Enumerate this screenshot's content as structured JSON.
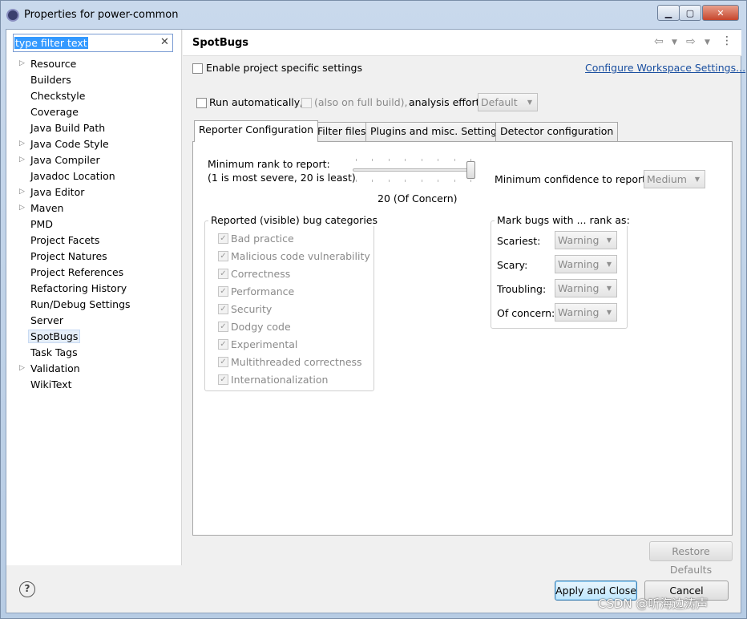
{
  "window": {
    "title": "Properties for power-common"
  },
  "filter": {
    "text": "type filter text",
    "clear_icon": "✕"
  },
  "tree": {
    "items": [
      {
        "label": "Resource",
        "expandable": true
      },
      {
        "label": "Builders",
        "expandable": false
      },
      {
        "label": "Checkstyle",
        "expandable": false
      },
      {
        "label": "Coverage",
        "expandable": false
      },
      {
        "label": "Java Build Path",
        "expandable": false
      },
      {
        "label": "Java Code Style",
        "expandable": true
      },
      {
        "label": "Java Compiler",
        "expandable": true
      },
      {
        "label": "Javadoc Location",
        "expandable": false
      },
      {
        "label": "Java Editor",
        "expandable": true
      },
      {
        "label": "Maven",
        "expandable": true
      },
      {
        "label": "PMD",
        "expandable": false
      },
      {
        "label": "Project Facets",
        "expandable": false
      },
      {
        "label": "Project Natures",
        "expandable": false
      },
      {
        "label": "Project References",
        "expandable": false
      },
      {
        "label": "Refactoring History",
        "expandable": false
      },
      {
        "label": "Run/Debug Settings",
        "expandable": false
      },
      {
        "label": "Server",
        "expandable": false
      },
      {
        "label": "SpotBugs",
        "expandable": false,
        "selected": true
      },
      {
        "label": "Task Tags",
        "expandable": false
      },
      {
        "label": "Validation",
        "expandable": true
      },
      {
        "label": "WikiText",
        "expandable": false
      }
    ]
  },
  "page": {
    "title": "SpotBugs",
    "enable_specific": "Enable project specific settings",
    "configure_link": "Configure Workspace Settings...",
    "run_auto": "Run automatically,",
    "full_build": "(also on full build),",
    "effort_label": "analysis effort",
    "effort_value": "Default"
  },
  "tabs": [
    "Reporter Configuration",
    "Filter files",
    "Plugins and misc. Settings",
    "Detector configuration"
  ],
  "reporter": {
    "min_rank_label": "Minimum rank to report:",
    "min_rank_hint": "(1 is most severe, 20 is least)",
    "rank_value_label": "20 (Of Concern)",
    "rank_value": 20,
    "rank_max": 20,
    "min_conf_label": "Minimum confidence to report:",
    "min_conf_value": "Medium",
    "categories_title": "Reported (visible) bug categories",
    "categories": [
      "Bad practice",
      "Malicious code vulnerability",
      "Correctness",
      "Performance",
      "Security",
      "Dodgy code",
      "Experimental",
      "Multithreaded correctness",
      "Internationalization"
    ],
    "mark_title": "Mark bugs with ... rank as:",
    "marks": [
      {
        "label": "Scariest:",
        "value": "Warning"
      },
      {
        "label": "Scary:",
        "value": "Warning"
      },
      {
        "label": "Troubling:",
        "value": "Warning"
      },
      {
        "label": "Of concern:",
        "value": "Warning"
      }
    ]
  },
  "buttons": {
    "restore": "Restore Defaults",
    "apply_close": "Apply and Close",
    "cancel": "Cancel",
    "help": "?"
  },
  "watermark": "CSDN @听海边涛声",
  "colors": {
    "selection": "#3399ff",
    "link": "#1a4fa0",
    "primary_button": "#bee6fd"
  }
}
